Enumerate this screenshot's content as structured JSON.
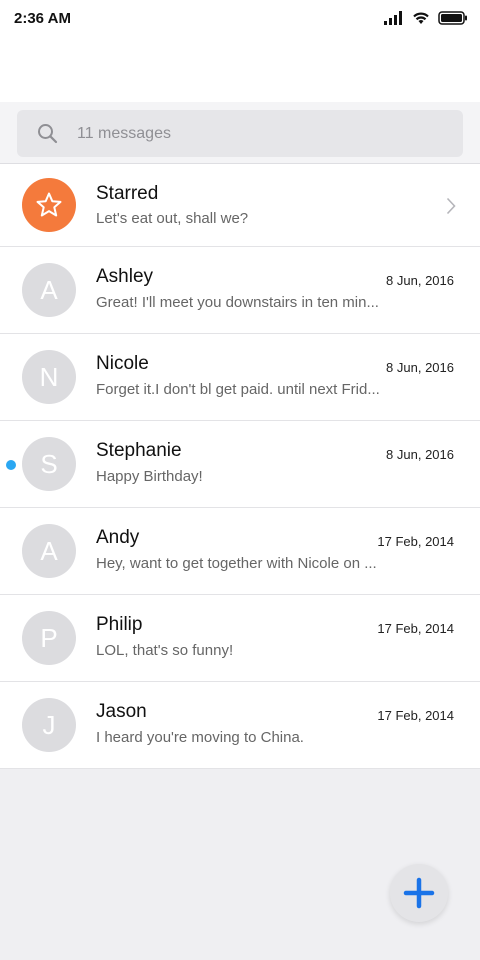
{
  "status_bar": {
    "time": "2:36 AM"
  },
  "search": {
    "placeholder": "11 messages"
  },
  "colors": {
    "accent": "#1a73e8",
    "starred": "#f47a3c",
    "unread": "#2aa7f2"
  },
  "starred": {
    "name": "Starred",
    "preview": "Let's eat out, shall we?",
    "icon": "star-icon"
  },
  "conversations": [
    {
      "initial": "A",
      "name": "Ashley",
      "date": "8 Jun, 2016",
      "preview": "Great! I'll meet you downstairs in ten min...",
      "unread": false
    },
    {
      "initial": "N",
      "name": "Nicole",
      "date": "8 Jun, 2016",
      "preview": "Forget it.I don't bl get paid. until next Frid...",
      "unread": false
    },
    {
      "initial": "S",
      "name": "Stephanie",
      "date": "8 Jun, 2016",
      "preview": "Happy Birthday!",
      "unread": true
    },
    {
      "initial": "A",
      "name": "Andy",
      "date": "17 Feb, 2014",
      "preview": "Hey, want to get together with Nicole on ...",
      "unread": false
    },
    {
      "initial": "P",
      "name": "Philip",
      "date": "17 Feb, 2014",
      "preview": "LOL, that's so funny!",
      "unread": false
    },
    {
      "initial": "J",
      "name": "Jason",
      "date": "17 Feb, 2014",
      "preview": "I heard you're moving to China.",
      "unread": false
    }
  ]
}
